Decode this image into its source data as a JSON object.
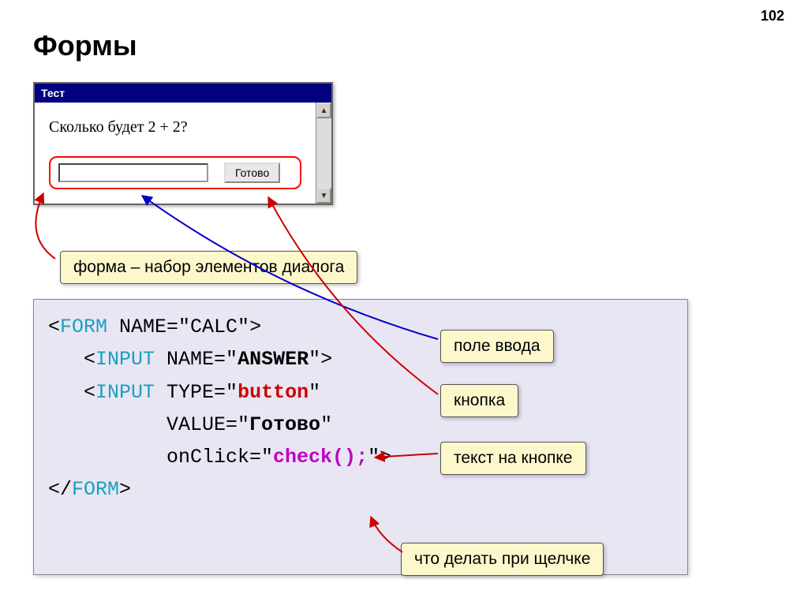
{
  "page_number": "102",
  "title": "Формы",
  "window": {
    "title": "Тест",
    "question": "Сколько будет 2 + 2?",
    "button_label": "Готово"
  },
  "callouts": {
    "form": "форма – набор элементов диалога",
    "input": "поле ввода",
    "button": "кнопка",
    "button_text": "текст на кнопке",
    "onclick": "что делать при щелчке"
  },
  "code": {
    "line1_open": "<",
    "line1_tag": "FORM",
    "line1_attr": " NAME=\"CALC\"",
    "line1_close": ">",
    "line2_open": "   <",
    "line2_tag": "INPUT",
    "line2_attr": " NAME=\"",
    "line2_val": "ANSWER",
    "line2_close": "\">",
    "line3_open": "   <",
    "line3_tag": "INPUT",
    "line3_attr": " TYPE=\"",
    "line3_val": "button",
    "line3_close": "\"",
    "line4": "          VALUE=\"",
    "line4_val": "Готово",
    "line4_close": "\"",
    "line5": "          onClick=\"",
    "line5_val": "check();",
    "line5_close": "\">",
    "line6_open": "</",
    "line6_tag": "FORM",
    "line6_close": ">"
  }
}
